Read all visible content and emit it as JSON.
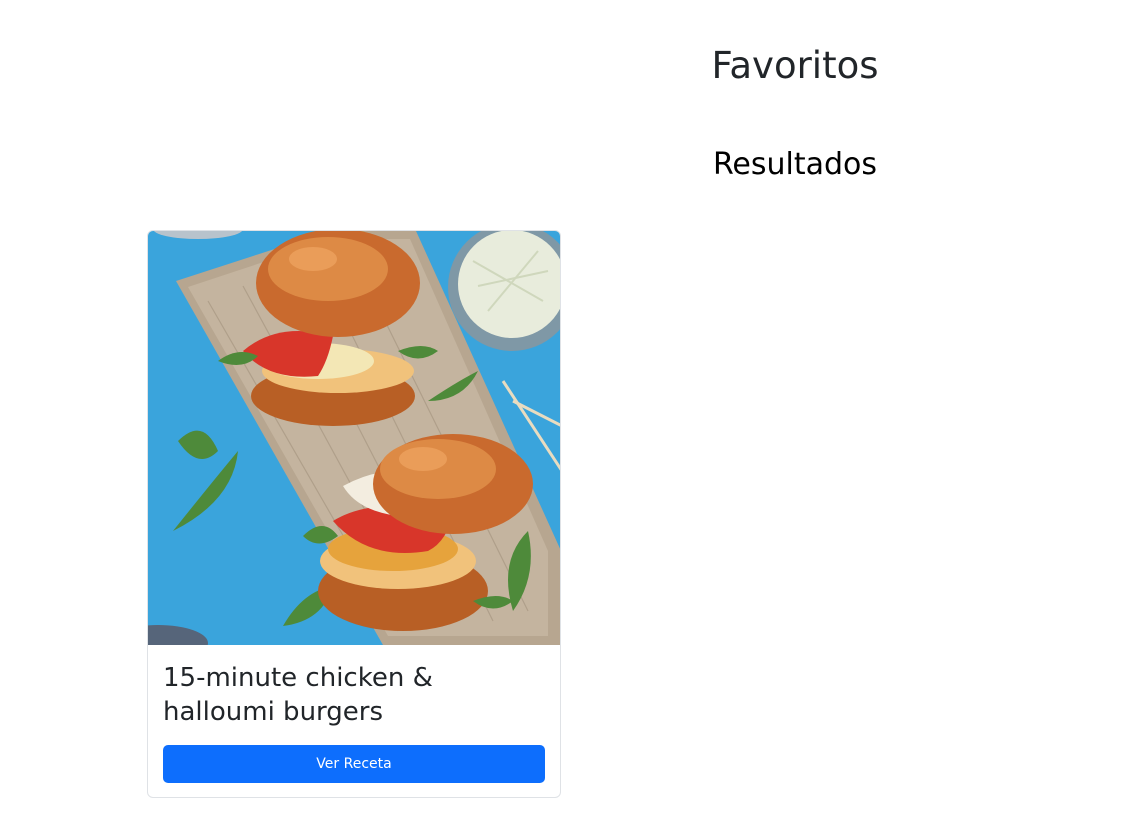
{
  "page": {
    "title": "Favoritos",
    "section_title": "Resultados"
  },
  "results": [
    {
      "title": "15-minute chicken & halloumi burgers",
      "button_label": "Ver Receta",
      "image_alt": "15-minute chicken & halloumi burgers"
    }
  ],
  "colors": {
    "accent": "#0d6efd",
    "text": "#212529",
    "card_border": "#dfe2e6",
    "photo_background": "#3ea9df"
  }
}
